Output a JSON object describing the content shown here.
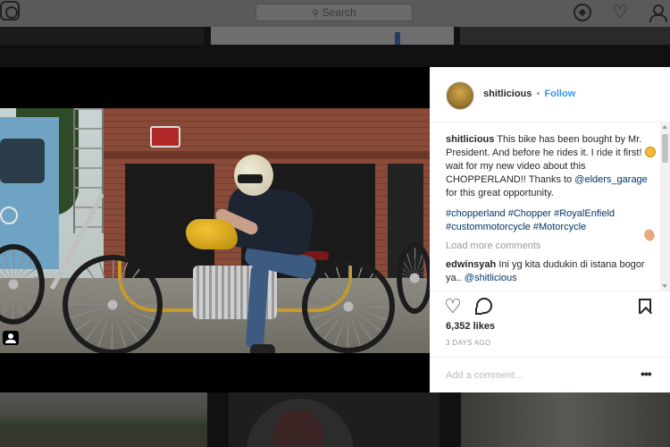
{
  "search": {
    "placeholder": "Search"
  },
  "nav": {
    "explore_icon": "compass-icon",
    "activity_icon": "heart-icon",
    "profile_icon": "person-icon"
  },
  "post": {
    "username": "shitlicious",
    "separator": "•",
    "follow_label": "Follow",
    "caption": {
      "username": "shitlicious",
      "text_1": "This bike has been bought by Mr. President. And before he rides it. I ride it first!",
      "text_2": "wait for my new video about this CHOPPERLAND!!",
      "text_3": "Thanks to",
      "mention": "@elders_garage",
      "text_4": "for this great opportunity."
    },
    "hashtags": [
      "#chopperland",
      "#Chopper",
      "#RoyalEnfield",
      "#custommotorcycle",
      "#Motorcycle"
    ],
    "load_more_label": "Load more comments",
    "comments": [
      {
        "username": "edwinsyah",
        "text": "Ini yg kita dudukin di istana bogor ya..",
        "mention": "@shitlicious"
      }
    ],
    "likes": "6,352 likes",
    "time": "3 DAYS AGO",
    "add_comment_placeholder": "Add a comment...",
    "more_label": "•••"
  },
  "colors": {
    "link": "#3897f0",
    "hashtag": "#003569",
    "overlay": "#111111"
  }
}
